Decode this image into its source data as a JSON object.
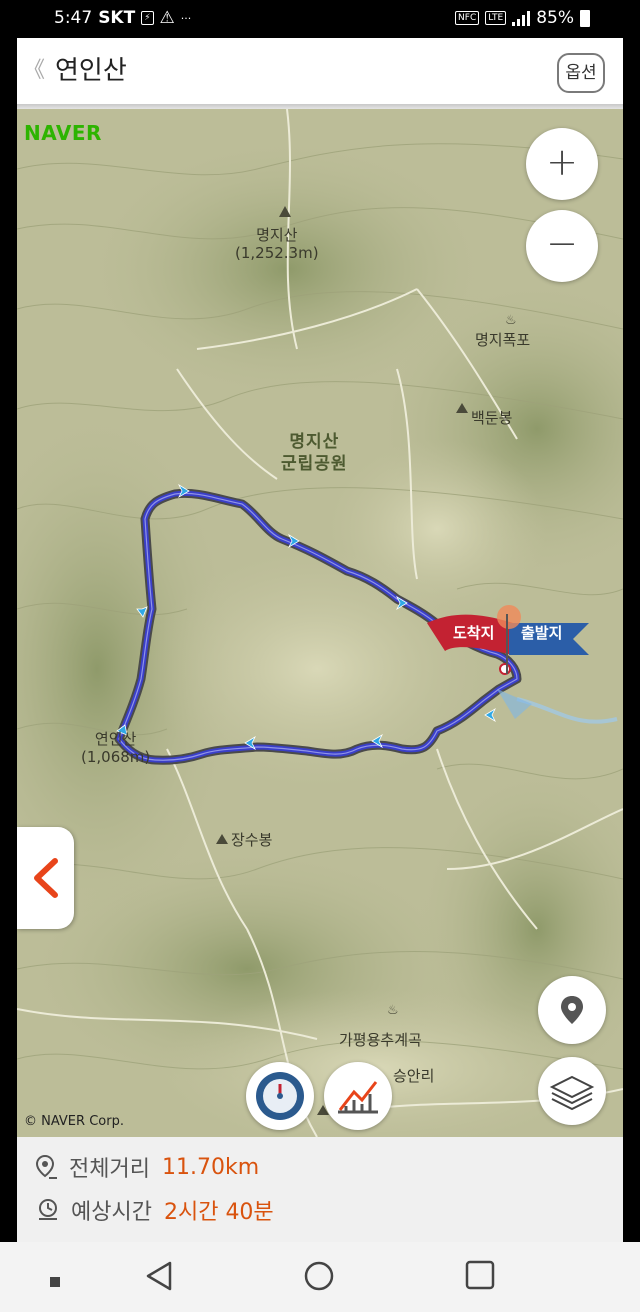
{
  "status_bar": {
    "time": "5:47",
    "carrier": "SKT",
    "overflow": "···",
    "battery": "85%",
    "icons": [
      "charging-box-icon",
      "warning-icon",
      "nfc-icon",
      "lte-icon",
      "signal-icon",
      "battery-icon"
    ]
  },
  "header": {
    "back_label": "《",
    "title": "연인산",
    "option_label": "옵션"
  },
  "map": {
    "provider_logo": "NAVER",
    "copyright": "© NAVER Corp.",
    "labels": {
      "peak1_name": "명지산",
      "peak1_elev": "(1,252.3m)",
      "falls": "명지폭포",
      "baekdunbong": "백둔봉",
      "park_line1": "명지산",
      "park_line2": "군립공원",
      "yeonin_name": "연인산",
      "yeonin_elev": "(1,068m)",
      "jangsubong": "장수봉",
      "gapyeong": "가평용추계곡",
      "seungan": "승안리"
    },
    "flags": {
      "arrive": "도착지",
      "start": "출발지"
    },
    "zoom_in": "+",
    "zoom_out": "−"
  },
  "info": {
    "distance_label": "전체거리",
    "distance_value": "11.70km",
    "time_label": "예상시간",
    "time_value": "2시간 40분"
  },
  "colors": {
    "accent": "#d9530e",
    "route": "#3a3fc9",
    "naver_green": "#2db400",
    "arrive_flag": "#c32232",
    "start_flag": "#2b5ea8"
  }
}
